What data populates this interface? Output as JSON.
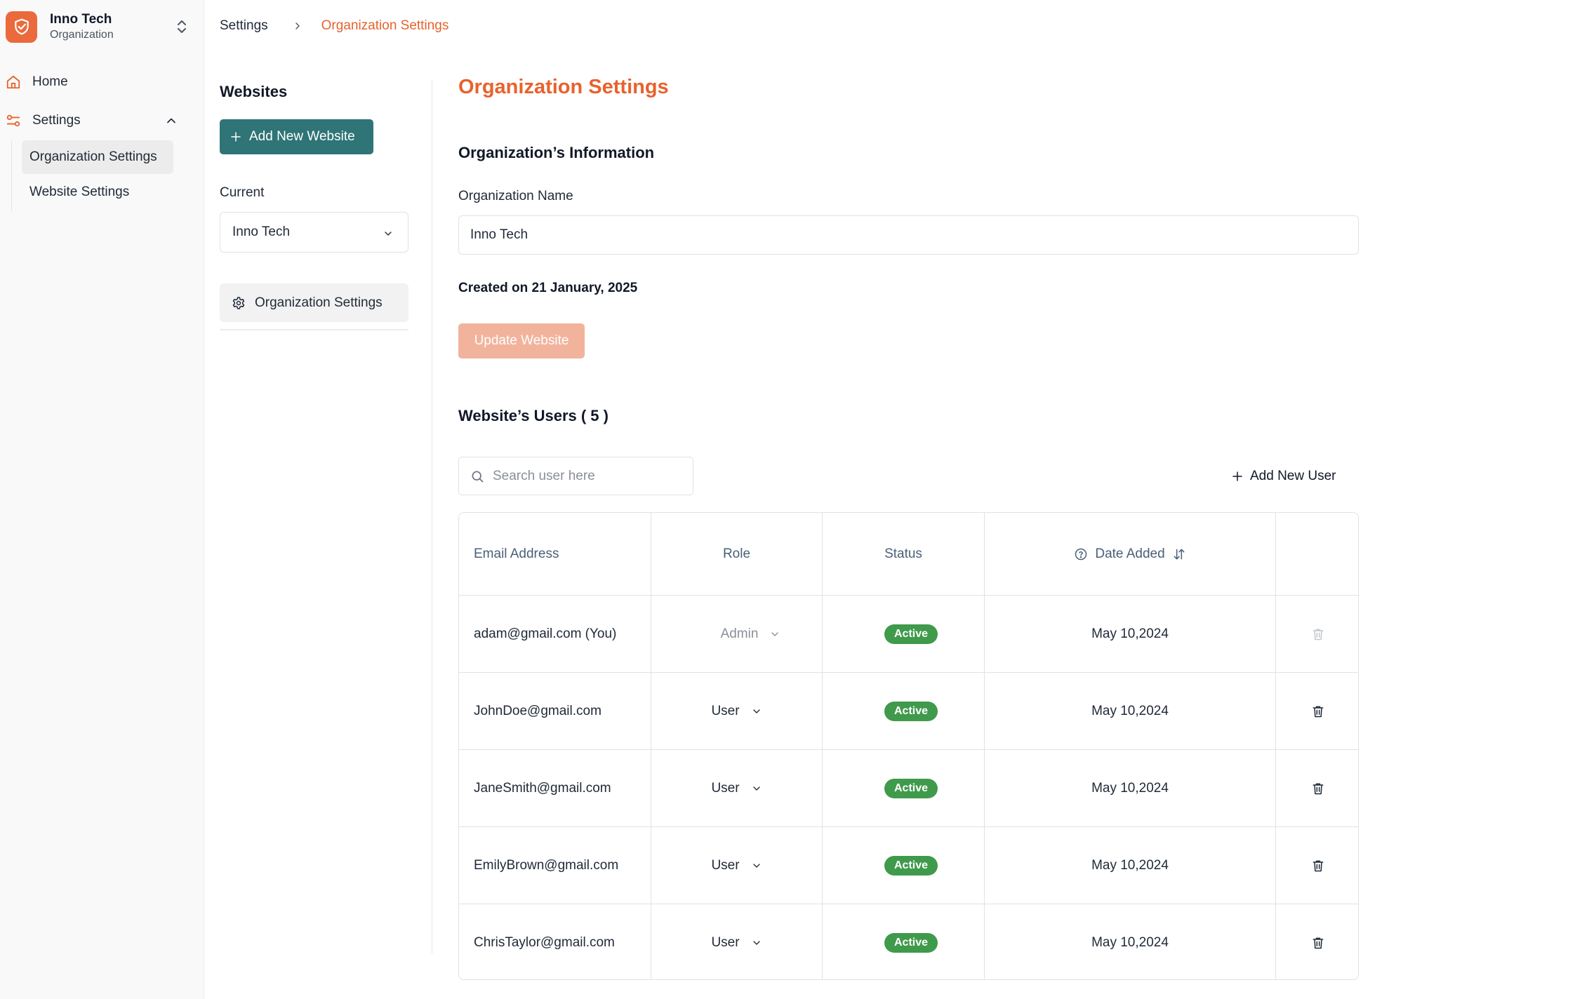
{
  "sidebar": {
    "org_name": "Inno Tech",
    "org_subtitle": "Organization",
    "nav": {
      "home": "Home",
      "settings": "Settings",
      "sub_items": [
        "Organization Settings",
        "Website Settings"
      ]
    }
  },
  "breadcrumb": {
    "parent": "Settings",
    "current": "Organization Settings"
  },
  "websites_panel": {
    "title": "Websites",
    "add_button": "Add New Website",
    "current_label": "Current",
    "current_value": "Inno Tech",
    "org_settings_item": "Organization Settings"
  },
  "main": {
    "page_title": "Organization Settings",
    "section_title": "Organization’s Information",
    "org_name_label": "Organization Name",
    "org_name_value": "Inno Tech",
    "created_text": "Created on 21 January, 2025",
    "update_button": "Update Website",
    "users_title": "Website’s Users ( 5 )",
    "search_placeholder": "Search user here",
    "add_user_button": "Add New User"
  },
  "table": {
    "headers": {
      "email": "Email Address",
      "role": "Role",
      "status": "Status",
      "date": "Date Added"
    },
    "rows": [
      {
        "email": "adam@gmail.com (You)",
        "role": "Admin",
        "status": "Active",
        "date": "May 10,2024"
      },
      {
        "email": "JohnDoe@gmail.com",
        "role": "User",
        "status": "Active",
        "date": "May 10,2024"
      },
      {
        "email": "JaneSmith@gmail.com",
        "role": "User",
        "status": "Active",
        "date": "May 10,2024"
      },
      {
        "email": "EmilyBrown@gmail.com",
        "role": "User",
        "status": "Active",
        "date": "May 10,2024"
      },
      {
        "email": "ChrisTaylor@gmail.com",
        "role": "User",
        "status": "Active",
        "date": "May 10,2024"
      }
    ]
  },
  "colors": {
    "accent": "#e8622d",
    "primary_button": "#2f7476",
    "status_active": "#3f9a4b",
    "disabled_button": "#f2b39c"
  },
  "icons": [
    "shield-logo-icon",
    "chevron-up-down-icon",
    "home-icon",
    "settings-sliders-icon",
    "chevron-up-icon",
    "chevron-right-icon",
    "plus-icon",
    "chevron-down-icon",
    "gear-icon",
    "search-icon",
    "help-circle-icon",
    "sort-icon",
    "trash-icon"
  ]
}
